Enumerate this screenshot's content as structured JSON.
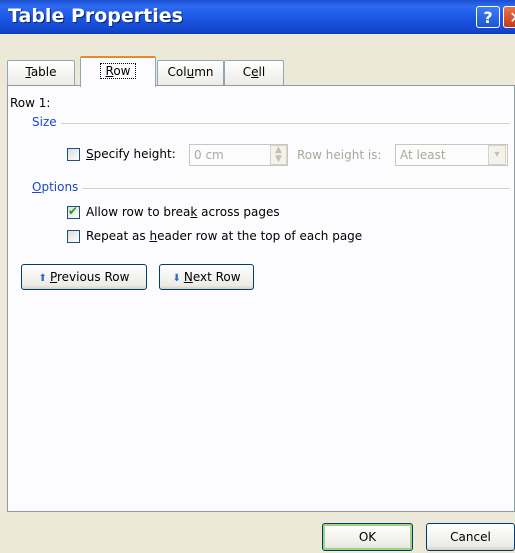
{
  "window": {
    "title": "Table Properties",
    "help_glyph": "?",
    "close_glyph": "✕"
  },
  "tabs": [
    {
      "label": "Table",
      "access_key": "T",
      "rest": "able"
    },
    {
      "label": "Row",
      "access_key": "R",
      "rest": "ow"
    },
    {
      "label": "Column",
      "pre": "Col",
      "access_key": "u",
      "rest": "mn"
    },
    {
      "label": "Cell",
      "pre": "C",
      "access_key": "e",
      "rest": "ll"
    }
  ],
  "selected_tab": "Row",
  "row_heading": "Row 1:",
  "size_group": {
    "label": "Size",
    "specify_height": {
      "pre": "",
      "access_key": "S",
      "rest": "pecify height:",
      "checked": false
    },
    "height_value": "0 cm",
    "row_height_is_label": "Row height is:",
    "row_height_is_value": "At least"
  },
  "options_group": {
    "label": "Options",
    "label_pre": "",
    "label_key": "O",
    "label_rest": "ptions",
    "allow_break": {
      "pre": "Allow row to brea",
      "access_key": "k",
      "rest": " across pages",
      "checked": true
    },
    "repeat_header": {
      "pre": "Repeat as ",
      "access_key": "h",
      "rest": "eader row at the top of each page",
      "checked": false
    }
  },
  "nav": {
    "previous": {
      "pre": "",
      "access_key": "P",
      "rest": "revious Row"
    },
    "next": {
      "pre": "",
      "access_key": "N",
      "rest": "ext Row"
    }
  },
  "footer": {
    "ok_label": "OK",
    "cancel_label": "Cancel"
  },
  "colors": {
    "title_bar": "#2458dc",
    "group_label": "#1a47c9",
    "selected_tab_accent": "#e68b2c",
    "dialog_bg": "#ece9d8"
  },
  "icons": {
    "previous": "up-arrow-icon",
    "next": "down-arrow-icon"
  }
}
